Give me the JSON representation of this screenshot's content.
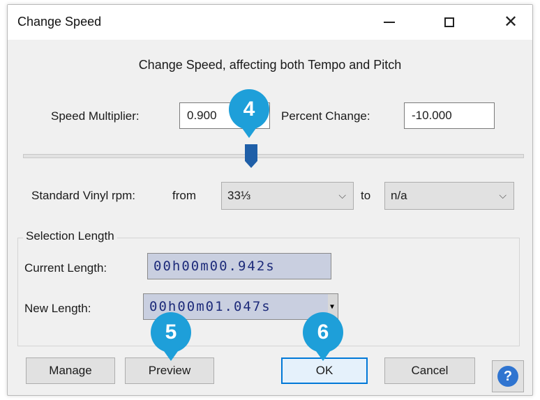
{
  "window": {
    "title": "Change Speed",
    "minimize_icon": "minimize-icon",
    "maximize_icon": "maximize-icon",
    "close_icon": "close-icon"
  },
  "heading": "Change Speed, affecting both Tempo and Pitch",
  "speed": {
    "multiplier_label": "Speed Multiplier:",
    "multiplier_value": "0.900",
    "percent_label": "Percent Change:",
    "percent_value": "-10.000",
    "slider_value": 0.9
  },
  "vinyl": {
    "label": "Standard Vinyl rpm:",
    "from_label": "from",
    "from_value": "33⅓",
    "to_label": "to",
    "to_value": "n/a"
  },
  "selection": {
    "group_title": "Selection Length",
    "current_label": "Current Length:",
    "current_value": "00h00m00.942s",
    "new_label": "New Length:",
    "new_value": "00h00m01.047s"
  },
  "buttons": {
    "manage": "Manage",
    "preview": "Preview",
    "ok": "OK",
    "cancel": "Cancel",
    "help": "?"
  },
  "steps": {
    "step4": "4",
    "step5": "5",
    "step6": "6"
  },
  "colors": {
    "step_badge": "#1e9fd9",
    "slider_thumb": "#1f5fa8",
    "time_text": "#1d2b7a",
    "help": "#2f74d0"
  }
}
